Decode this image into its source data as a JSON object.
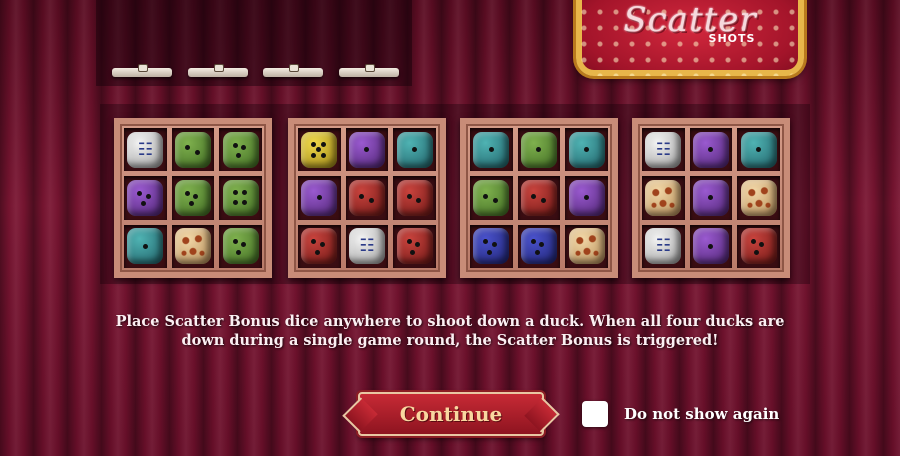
{
  "logo": {
    "title": "Scatter",
    "subtitle": "SHOTS"
  },
  "duck_count": 4,
  "crates": [
    {
      "dice": [
        "white-scatter",
        "green-2",
        "green-3",
        "purple-3",
        "green-3",
        "green-4",
        "teal-1",
        "leopard",
        "green-3"
      ]
    },
    {
      "dice": [
        "yellow-5",
        "purple-1",
        "teal-1",
        "purple-1",
        "red-2",
        "red-2",
        "red-3",
        "white-scatter",
        "red-3"
      ]
    },
    {
      "dice": [
        "teal-1",
        "green-1",
        "teal-1",
        "green-2",
        "red-2",
        "purple-1",
        "blue-3",
        "blue-3",
        "leopard"
      ]
    },
    {
      "dice": [
        "white-scatter",
        "purple-1",
        "teal-1",
        "leopard",
        "purple-1",
        "leopard",
        "white-scatter",
        "purple-1",
        "red-3"
      ]
    }
  ],
  "message": {
    "line1": "Place Scatter Bonus dice anywhere to shoot down a duck. When all four ducks are",
    "line2": "down during a single game round, the Scatter Bonus is triggered!"
  },
  "buttons": {
    "continue": "Continue"
  },
  "checkbox": {
    "label": "Do not show again",
    "checked": false
  },
  "colors": {
    "curtain": "#6a0f2a",
    "button": "#b21f2c",
    "button_text": "#f9d7a0",
    "logo_border": "#e8b64a"
  }
}
